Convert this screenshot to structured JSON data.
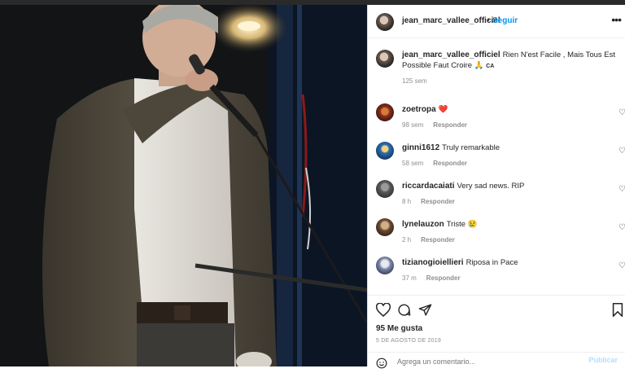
{
  "post": {
    "username": "jean_marc_vallee_officiel",
    "follow_label": "Seguir",
    "more_label": "•••",
    "caption": {
      "username": "jean_marc_vallee_officiel",
      "text": "Rien N'est Facile , Mais Tous Est Possible Faut Croire 🙏",
      "suffix": "CA",
      "time": "125 sem"
    },
    "likes": "95 Me gusta",
    "date": "5 DE AGOSTO DE 2019",
    "add_comment_placeholder": "Agrega un comentario...",
    "publish_label": "Publicar"
  },
  "comments": [
    {
      "username": "zoetropa",
      "text": "❤️",
      "time": "98 sem",
      "reply": "Responder"
    },
    {
      "username": "ginni1612",
      "text": "Truly remarkable",
      "time": "58 sem",
      "reply": "Responder"
    },
    {
      "username": "riccardacaiati",
      "text": "Very sad news. RIP",
      "time": "8 h",
      "reply": "Responder"
    },
    {
      "username": "lynelauzon",
      "text": "Triste 😢",
      "time": "2 h",
      "reply": "Responder"
    },
    {
      "username": "tizianogioiellieri",
      "text": "Riposa in Pace",
      "time": "37 m",
      "reply": "Responder"
    }
  ],
  "icons": {
    "like": "heart-icon",
    "comment": "comment-icon",
    "share": "share-icon",
    "save": "bookmark-icon",
    "emoji": "smiley-icon"
  }
}
